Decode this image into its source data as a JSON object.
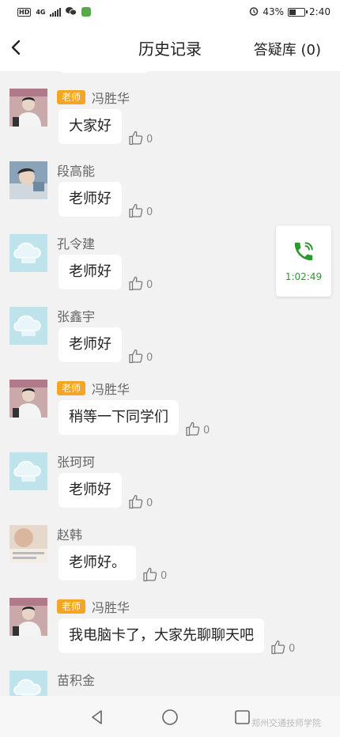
{
  "status_bar": {
    "hd": "HD",
    "network": "4G",
    "battery_percent": "43%",
    "time": "2:40",
    "icons": [
      "hd-icon",
      "signal-icon",
      "wechat-icon",
      "app-icon",
      "alarm-icon",
      "battery-icon"
    ]
  },
  "header": {
    "title": "历史记录",
    "qa_library": "答疑库 (0)",
    "back_icon": "chevron-left-icon"
  },
  "badges": {
    "teacher": "老师"
  },
  "messages": [
    {
      "name": "冯胜华",
      "is_teacher": true,
      "avatar": "teacher-photo",
      "text": "大家好",
      "likes": "0"
    },
    {
      "name": "段高能",
      "is_teacher": false,
      "avatar": "student-photo",
      "text": "老师好",
      "likes": "0"
    },
    {
      "name": "孔令建",
      "is_teacher": false,
      "avatar": "default-cloud-avatar",
      "text": "老师好",
      "likes": "0"
    },
    {
      "name": "张鑫宇",
      "is_teacher": false,
      "avatar": "default-cloud-avatar",
      "text": "老师好",
      "likes": "0"
    },
    {
      "name": "冯胜华",
      "is_teacher": true,
      "avatar": "teacher-photo",
      "text": "稍等一下同学们",
      "likes": "0"
    },
    {
      "name": "张珂珂",
      "is_teacher": false,
      "avatar": "default-cloud-avatar",
      "text": "老师好",
      "likes": "0"
    },
    {
      "name": "赵韩",
      "is_teacher": false,
      "avatar": "student-photo-2",
      "text": "老师好。",
      "likes": "0"
    },
    {
      "name": "冯胜华",
      "is_teacher": true,
      "avatar": "teacher-photo",
      "text": "我电脑卡了，大家先聊聊天吧",
      "likes": "0"
    },
    {
      "name": "苗积金",
      "is_teacher": false,
      "avatar": "default-cloud-avatar",
      "text": "",
      "likes": ""
    }
  ],
  "call_widget": {
    "duration": "1:02:49",
    "icon": "phone-icon",
    "color": "#2a9a2a"
  },
  "nav_bar": {
    "icons": [
      "back-triangle-icon",
      "home-circle-icon",
      "recent-square-icon"
    ],
    "watermark": "郑州交通技师学院"
  },
  "colors": {
    "teacher_badge": "#f5a524",
    "background": "#f2f2f2",
    "bubble": "#ffffff"
  }
}
